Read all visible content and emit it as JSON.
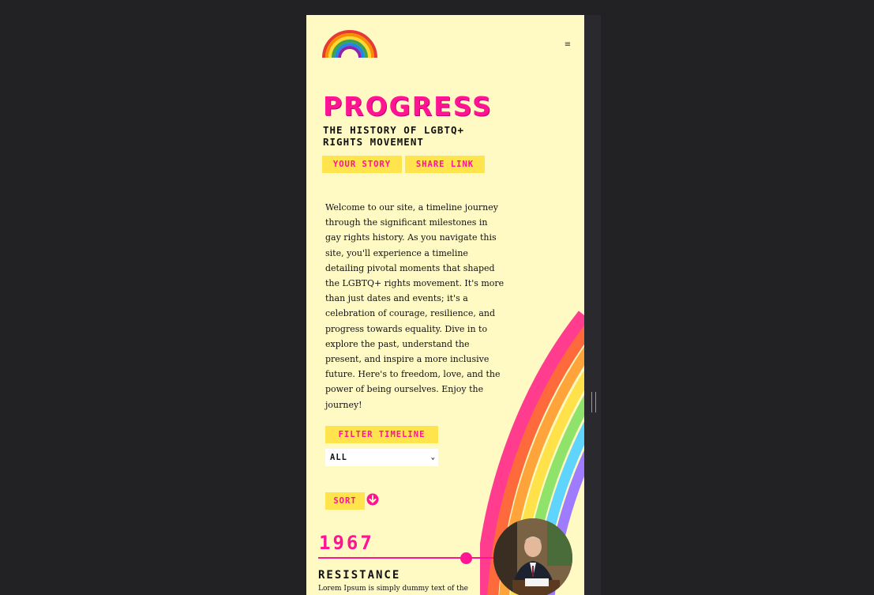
{
  "colors": {
    "accent": "#ff1493",
    "button_bg": "#ffe44d",
    "page_bg": "#fff9c4",
    "outer_bg": "#222225"
  },
  "header": {
    "logo_icon": "rainbow-logo-icon",
    "menu_icon": "hamburger-menu-icon",
    "menu_glyph": "≡"
  },
  "hero": {
    "title": "PROGRESS",
    "subtitle": "THE HISTORY OF LGBTQ+ RIGHTS MOVEMENT",
    "buttons": {
      "story": "YOUR STORY",
      "share": "SHARE LINK"
    }
  },
  "intro": "Welcome to our site, a timeline journey through the significant milestones in gay rights history. As you navigate this site, you'll experience a timeline detailing pivotal moments that shaped the LGBTQ+ rights movement. It's more than just dates and events; it's a celebration of courage, resilience, and progress towards equality. Dive in to explore the past, understand the present, and inspire a more inclusive future. Here's to freedom, love, and the power of being ourselves. Enjoy the journey!",
  "filter": {
    "label": "FILTER TIMELINE",
    "selected": "ALL"
  },
  "sort": {
    "label": "SORT",
    "icon": "arrow-down-circle-icon"
  },
  "timeline": {
    "events": [
      {
        "year": "1967",
        "title": "RESISTANCE",
        "description": "Lorem Ipsum is simply dummy text of the"
      }
    ]
  }
}
